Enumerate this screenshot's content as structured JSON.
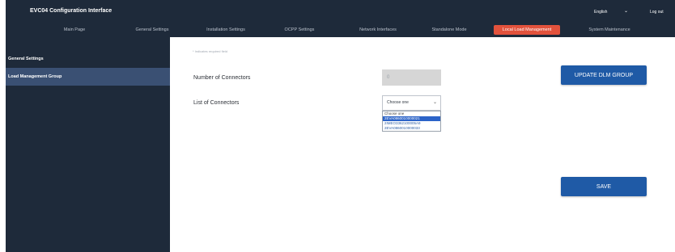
{
  "header": {
    "app_title": "EVC04 Configuration Interface",
    "language": "English",
    "logout": "Log out"
  },
  "nav": {
    "tabs": [
      {
        "label": "Main Page"
      },
      {
        "label": "General Settings"
      },
      {
        "label": "Installation Settings"
      },
      {
        "label": "OCPP Settings"
      },
      {
        "label": "Network Interfaces"
      },
      {
        "label": "Standalone Mode"
      },
      {
        "label": "Local Load Management"
      },
      {
        "label": "System Maintenance"
      }
    ],
    "active_tab": "Local Load Management"
  },
  "sidebar": {
    "items": [
      {
        "label": "General Settings"
      },
      {
        "label": "Load Management Group"
      }
    ],
    "active_item": "Load Management Group"
  },
  "form": {
    "required_note": "* Indicates required field",
    "number_of_connectors_label": "Number of Connectors",
    "number_of_connectors_value": "0",
    "list_of_connectors_label": "List of Connectors",
    "select_value": "Choose one",
    "options": [
      "Choose one",
      "2EVA0860010000021",
      "2IMEO3362100005A9",
      "2EVA0860010000033"
    ],
    "selected_option_index": 1
  },
  "buttons": {
    "update_dlm_group": "UPDATE DLM GROUP",
    "save": "SAVE"
  },
  "colors": {
    "header_bg": "#1e2a3a",
    "active_tab": "#e2523c",
    "sidebar_active": "#3a5073",
    "button_bg": "#1f5aa6",
    "dropdown_highlight": "#2b63c8"
  }
}
